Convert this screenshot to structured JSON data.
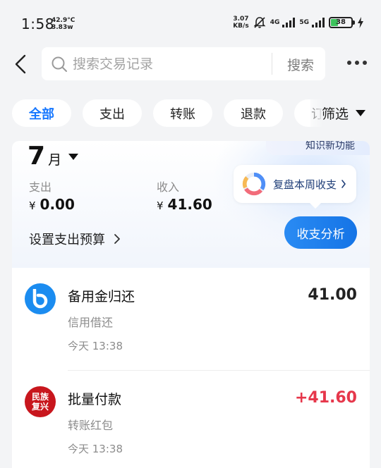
{
  "status_bar": {
    "time": "1:58",
    "temperature": "42.9°C",
    "power": "3.83w",
    "net_speed_value": "3.07",
    "net_speed_unit": "KB/s",
    "net_4g": "4G",
    "net_5g": "5G",
    "battery_level": "38"
  },
  "header": {
    "search_placeholder": "搜索交易记录",
    "search_button": "搜索"
  },
  "tabs": [
    {
      "label": "全部",
      "active": true
    },
    {
      "label": "支出",
      "active": false
    },
    {
      "label": "转账",
      "active": false
    },
    {
      "label": "退款",
      "active": false
    },
    {
      "label": "订单",
      "active": false
    }
  ],
  "filter_label": "筛选",
  "summary": {
    "month_number": "7",
    "month_unit": "月",
    "expense_label": "支出",
    "expense_currency": "¥",
    "expense_value": "0.00",
    "income_label": "收入",
    "income_currency": "¥",
    "income_value": "41.60",
    "budget_link": "设置支出预算",
    "new_feature_text": "知识新功能",
    "review_link": "复盘本周收支",
    "analysis_button": "收支分析"
  },
  "transactions": [
    {
      "title": "备用金归还",
      "category": "信用借还",
      "time": "今天 13:38",
      "amount": "41.00",
      "icon": "b-logo-icon"
    },
    {
      "title": "批量付款",
      "category": "转账红包",
      "time": "今天 13:38",
      "amount": "+41.60",
      "icon": "brand-seal-icon",
      "icon_text_line1": "民族",
      "icon_text_line2": "复兴"
    }
  ],
  "colors": {
    "accent_blue": "#1677ff",
    "income_red": "#e6374b",
    "button_blue": "#1e80ee",
    "background": "#f3f4f6"
  }
}
